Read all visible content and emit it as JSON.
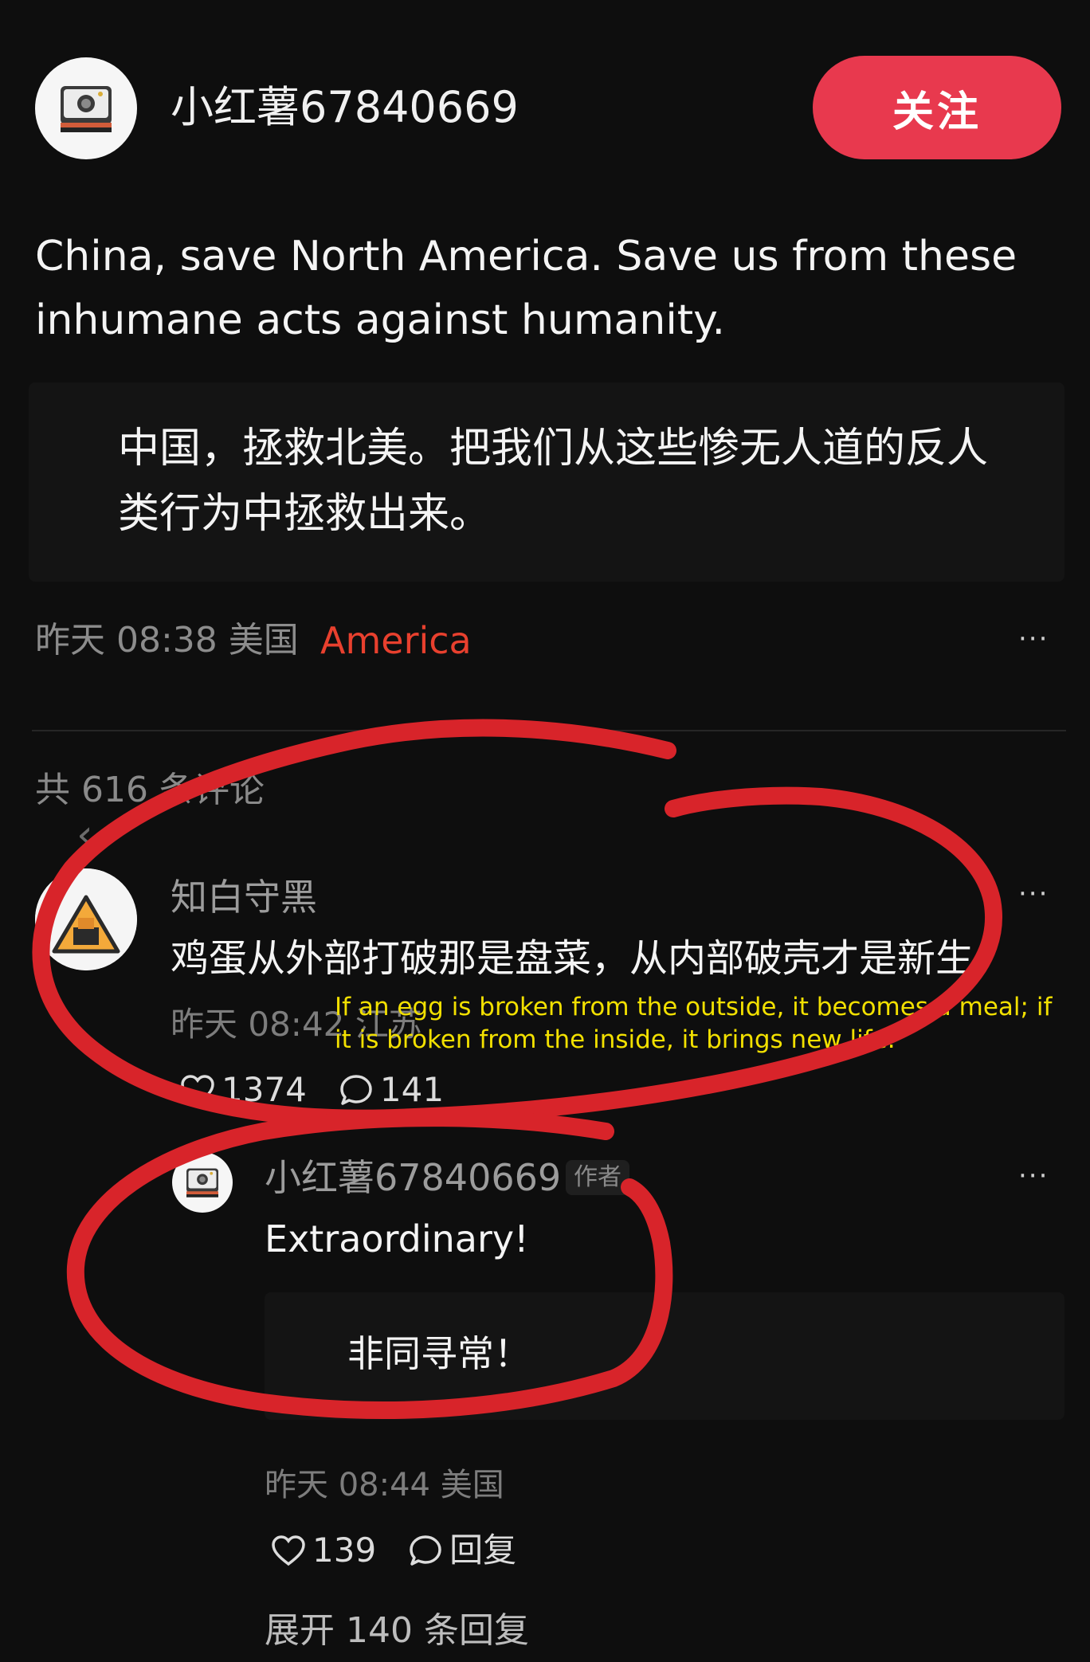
{
  "post": {
    "author": "小红薯67840669",
    "follow_label": "关注",
    "text_en": "China, save North America. Save us from these inhumane acts against humanity.",
    "text_cn": "中国，拯救北美。把我们从这些惨无人道的反人类行为中拯救出来。",
    "time_location": "昨天 08:38 美国",
    "location_translation": "America",
    "more_label": "···"
  },
  "comments": {
    "count_label": "共 616 条评论",
    "back_icon": "‹"
  },
  "comment1": {
    "author": "知白守黑",
    "text": "鸡蛋从外部打破那是盘菜，从内部破壳才是新生。",
    "translation": "If an egg is broken from the outside, it becomes a meal; if it is broken from the inside, it brings new life.",
    "time_location": "昨天 08:42 江苏",
    "likes": "1374",
    "replies": "141",
    "more_label": "···"
  },
  "reply1": {
    "author": "小红薯67840669",
    "badge": "作者",
    "text_en": "Extraordinary!",
    "text_cn": "非同寻常！",
    "time_location": "昨天 08:44 美国",
    "likes": "139",
    "reply_label": "回复",
    "more_label": "···"
  },
  "expand_label": "展开 140 条回复",
  "colors": {
    "background": "#0e0e0e",
    "follow_button": "#e8394e",
    "annotation_red": "#d8242a",
    "translation_yellow": "#f2e000",
    "location_translation": "#e8402e"
  }
}
